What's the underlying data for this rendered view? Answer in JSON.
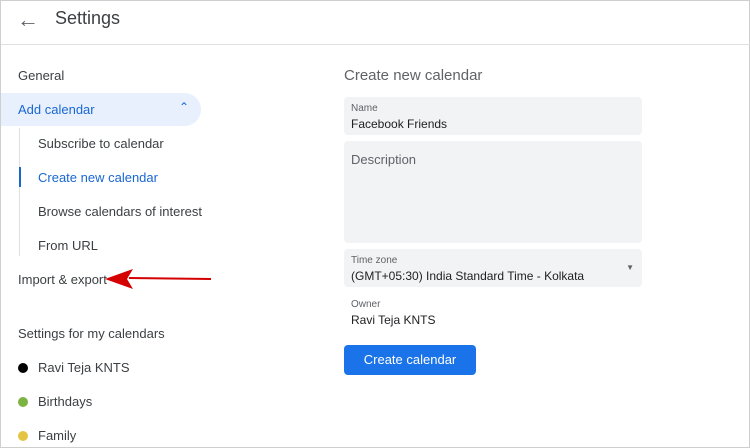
{
  "header": {
    "title": "Settings",
    "back_icon": "arrow-left-icon"
  },
  "sidebar": {
    "general": "General",
    "add_calendar": "Add calendar",
    "sub_items": [
      "Subscribe to calendar",
      "Create new calendar",
      "Browse calendars of interest",
      "From URL"
    ],
    "active_sub": "Create new calendar",
    "import_export": "Import & export",
    "section_title": "Settings for my calendars",
    "calendars": [
      {
        "name": "Ravi Teja KNTS",
        "color": "#000000"
      },
      {
        "name": "Birthdays",
        "color": "#7cb342"
      },
      {
        "name": "Family",
        "color": "#e4c441"
      }
    ]
  },
  "annotation": {
    "arrow_color": "#d50000"
  },
  "main": {
    "title": "Create new calendar",
    "name_label": "Name",
    "name_value": "Facebook Friends",
    "description_placeholder": "Description",
    "timezone_label": "Time zone",
    "timezone_value": "(GMT+05:30) India Standard Time - Kolkata",
    "owner_label": "Owner",
    "owner_value": "Ravi Teja KNTS",
    "create_button": "Create calendar"
  },
  "colors": {
    "accent": "#1a73e8",
    "active_text": "#1967d2",
    "active_bg": "#e8f0fe"
  }
}
